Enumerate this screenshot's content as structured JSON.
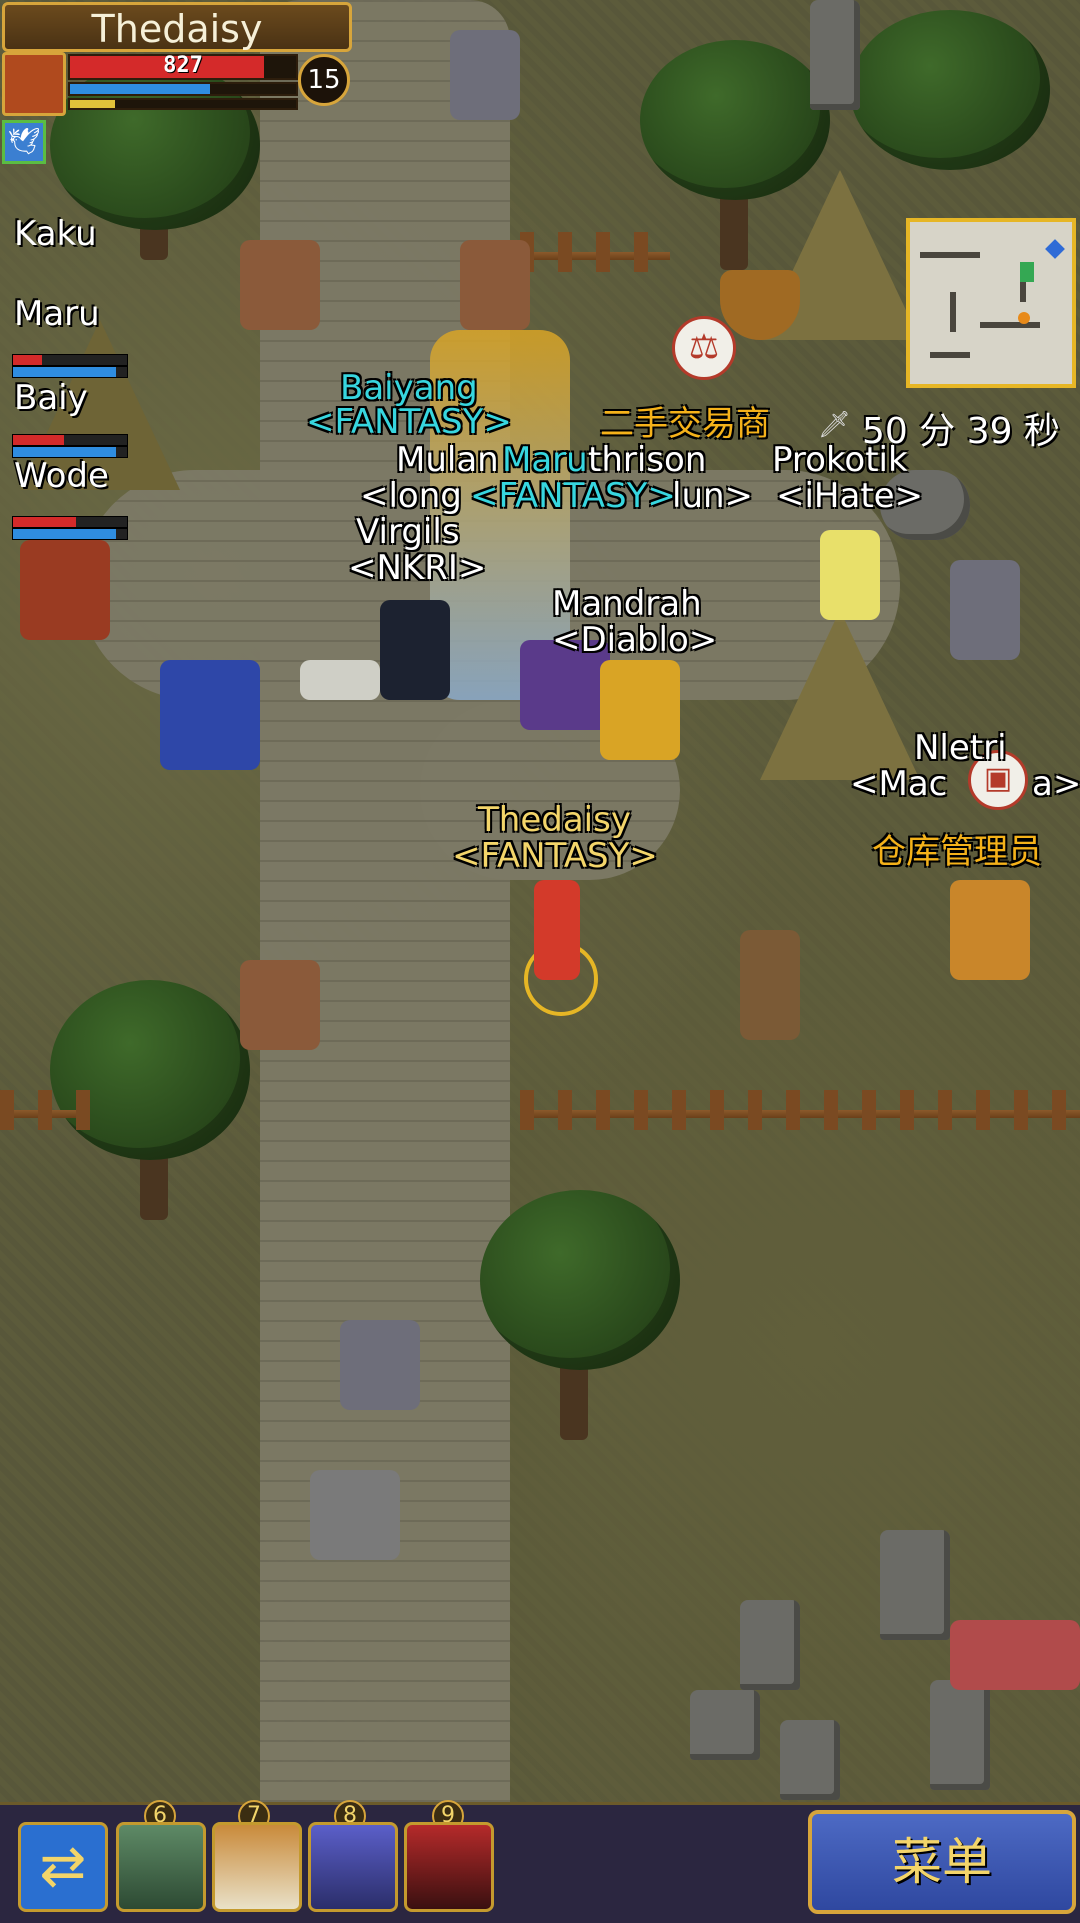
{
  "player": {
    "name": "Thedaisy",
    "hp": "827",
    "hp_fraction": 0.86,
    "mp_fraction": 0.62,
    "xp_fraction": 0.2,
    "level": "15"
  },
  "party": [
    {
      "name": "Kaku"
    },
    {
      "name": "Maru",
      "hp_fraction": 0.25,
      "mp_fraction": 0.9
    },
    {
      "name": "Baiy",
      "hp_fraction": 0.45,
      "mp_fraction": 0.9
    },
    {
      "name": "Wode",
      "hp_fraction": 0.55,
      "mp_fraction": 0.9
    }
  ],
  "timer": "50 分 39 秒",
  "world_labels": {
    "baiyang_name": "Baiyang",
    "baiyang_guild": "<FANTASY>",
    "merchant": "二手交易商",
    "mulan_name": "Mulan",
    "mulan_guild": "<long",
    "maru_name": "Maru",
    "maru_guild": "<FANTASY>",
    "thrison_name": "thrison",
    "thrison_guild": "lun>",
    "prokotik_name": "Prokotik",
    "prokotik_guild": "<iHate>",
    "virgils_name": "Virgils",
    "virgils_guild": "<NKRI>",
    "mandrah_name": "Mandrah",
    "mandrah_guild": "<Diablo>",
    "nletri_name": "Nletri",
    "nletri_guild": "<Mac",
    "nletri_guild_tail": "a>",
    "warehouse": "仓库管理员",
    "thedaisy_name": "Thedaisy",
    "thedaisy_guild": "<FANTASY>"
  },
  "hotbar": [
    {
      "number": "6",
      "icon": "zombie-head-icon"
    },
    {
      "number": "7",
      "icon": "mushroom-icon"
    },
    {
      "number": "8",
      "icon": "ghost-icon"
    },
    {
      "number": "9",
      "icon": "red-beetle-icon"
    }
  ],
  "menu_label": "菜单",
  "refresh_icon": "swap-arrows-icon"
}
